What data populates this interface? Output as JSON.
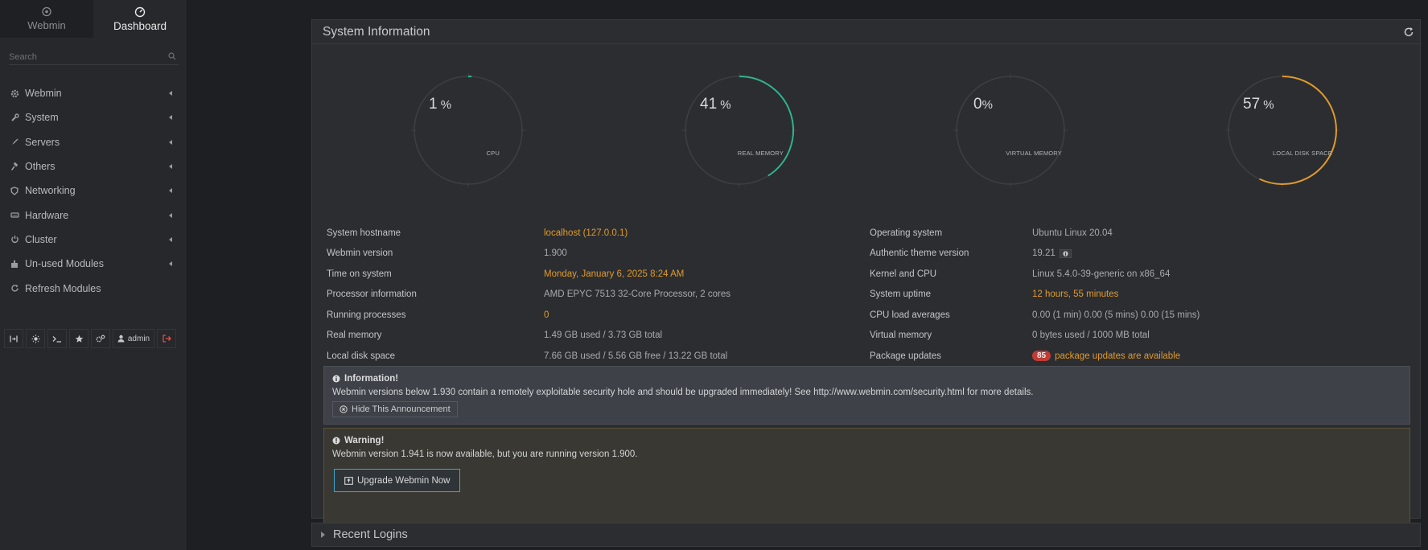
{
  "tabs": {
    "webmin": "Webmin",
    "dashboard": "Dashboard"
  },
  "search": {
    "placeholder": "Search"
  },
  "menu": [
    {
      "label": "Webmin",
      "icon": "gear-icon"
    },
    {
      "label": "System",
      "icon": "wrench-icon"
    },
    {
      "label": "Servers",
      "icon": "rocket-icon"
    },
    {
      "label": "Others",
      "icon": "gavel-icon"
    },
    {
      "label": "Networking",
      "icon": "shield-icon"
    },
    {
      "label": "Hardware",
      "icon": "drive-icon"
    },
    {
      "label": "Cluster",
      "icon": "power-icon"
    },
    {
      "label": "Un-used Modules",
      "icon": "puzzle-icon"
    },
    {
      "label": "Refresh Modules",
      "icon": "refresh-icon"
    }
  ],
  "bottombar": {
    "admin": "admin"
  },
  "panel": {
    "title": "System Information"
  },
  "gauges": [
    {
      "value": "1",
      "unit": "%",
      "label": "CPU",
      "percent": 1,
      "color": "#2fb390"
    },
    {
      "value": "41",
      "unit": "%",
      "label": "REAL MEMORY",
      "percent": 41,
      "color": "#2fb390"
    },
    {
      "value": "0",
      "unit": "%",
      "label": "VIRTUAL MEMORY",
      "percent": 0,
      "color": "#2fb390"
    },
    {
      "value": "57",
      "unit": "%",
      "label": "LOCAL DISK SPACE",
      "percent": 57,
      "color": "#e09a2b"
    }
  ],
  "info": {
    "left": [
      {
        "key": "System hostname",
        "value": "localhost (127.0.0.1)",
        "accent": true
      },
      {
        "key": "Webmin version",
        "value": "1.900",
        "accent": false
      },
      {
        "key": "Time on system",
        "value": "Monday, January 6, 2025 8:24 AM",
        "accent": true
      },
      {
        "key": "Processor information",
        "value": "AMD EPYC 7513 32-Core Processor, 2 cores",
        "accent": false
      },
      {
        "key": "Running processes",
        "value": "0",
        "accent": true
      },
      {
        "key": "Real memory",
        "value": "1.49 GB used / 3.73 GB total",
        "accent": false
      },
      {
        "key": "Local disk space",
        "value": "7.66 GB used / 5.56 GB free / 13.22 GB total",
        "accent": false
      }
    ],
    "right": [
      {
        "key": "Operating system",
        "value": "Ubuntu Linux 20.04",
        "accent": false
      },
      {
        "key": "Authentic theme version",
        "value": "19.21",
        "accent": false
      },
      {
        "key": "Kernel and CPU",
        "value": "Linux 5.4.0-39-generic on x86_64",
        "accent": false
      },
      {
        "key": "System uptime",
        "value": "12 hours, 55 minutes",
        "accent": true
      },
      {
        "key": "CPU load averages",
        "value": "0.00 (1 min) 0.00 (5 mins) 0.00 (15 mins)",
        "accent": false
      },
      {
        "key": "Virtual memory",
        "value": "0 bytes used / 1000 MB total",
        "accent": false
      },
      {
        "key": "Package updates",
        "value": "package updates are available",
        "badge": "85",
        "accent": true
      }
    ]
  },
  "info_alert": {
    "title": "Information!",
    "text": "Webmin versions below 1.930 contain a remotely exploitable security hole and should be upgraded immediately! See http://www.webmin.com/security.html for more details.",
    "button": "Hide This Announcement"
  },
  "warn_alert": {
    "title": "Warning!",
    "text": "Webmin version 1.941 is now available, but you are running version 1.900.",
    "button": "Upgrade Webmin Now"
  },
  "recent": {
    "title": "Recent Logins"
  }
}
